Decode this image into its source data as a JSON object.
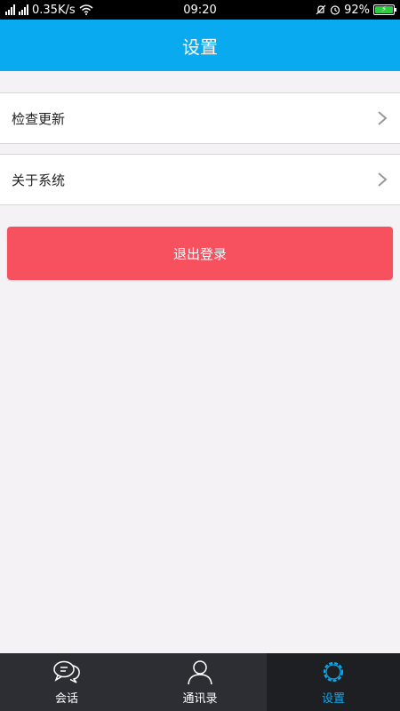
{
  "status_bar": {
    "network_speed": "0.35K/s",
    "time": "09:20",
    "battery": "92%",
    "icons": [
      "signal-icon",
      "signal-icon",
      "wifi-icon",
      "mute-icon",
      "alarm-icon",
      "battery-icon"
    ]
  },
  "header": {
    "title": "设置"
  },
  "menu": {
    "items": [
      {
        "label": "检查更新",
        "icon": "chevron-right-icon"
      },
      {
        "label": "关于系统",
        "icon": "chevron-right-icon"
      }
    ]
  },
  "logout": {
    "label": "退出登录",
    "color": "#f7505f"
  },
  "tabbar": {
    "tabs": [
      {
        "label": "会话",
        "icon": "chat-bubbles-icon",
        "active": false
      },
      {
        "label": "通讯录",
        "icon": "contact-person-icon",
        "active": false
      },
      {
        "label": "设置",
        "icon": "settings-gear-icon",
        "active": true
      }
    ]
  },
  "colors": {
    "accent": "#0aaaf0",
    "background": "#f4f2f5",
    "tabbar": "#2c2e33",
    "tabbar_active": "#1d1f23"
  }
}
